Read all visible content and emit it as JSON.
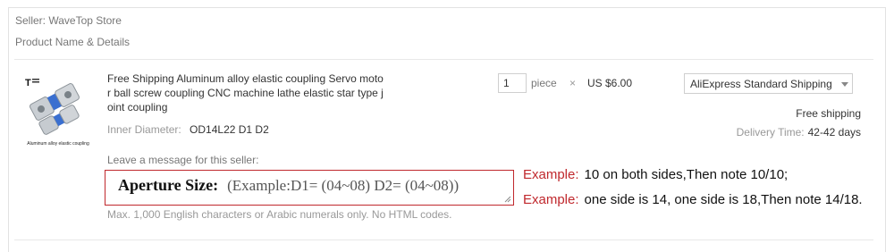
{
  "seller": {
    "label": "Seller: WaveTop Store"
  },
  "section": {
    "header": "Product Name & Details"
  },
  "product": {
    "thumbnail_caption": "Aluminum alloy elastic coupling",
    "title": "Free Shipping Aluminum alloy elastic coupling Servo motor ball screw coupling CNC machine lathe elastic star type joint coupling",
    "attribute_label": "Inner Diameter:",
    "attribute_value": "OD14L22 D1 D2"
  },
  "order": {
    "quantity": "1",
    "unit": "piece",
    "times_symbol": "×",
    "price": "US $6.00"
  },
  "shipping": {
    "selected_method": "AliExpress Standard Shipping",
    "cost": "Free shipping",
    "delivery_label": "Delivery Time:",
    "delivery_value": "42-42 days"
  },
  "message": {
    "label": "Leave a message for this seller:",
    "aperture_label": "Aperture Size:",
    "aperture_example": "(Example:D1= (04~08) D2= (04~08))",
    "hint": "Max. 1,000 English characters or Arabic numerals only. No HTML codes."
  },
  "examples": [
    {
      "key": "Example:",
      "text": "10 on both sides,Then note 10/10;"
    },
    {
      "key": "Example:",
      "text": "one side is 14, one side is 18,Then note 14/18."
    }
  ],
  "colors": {
    "accent_red": "#c0282d",
    "muted_text": "#999999",
    "border": "#e2e2e2"
  },
  "icons": {
    "dropdown": "chevron-down-icon",
    "product": "coupling-product-image"
  }
}
